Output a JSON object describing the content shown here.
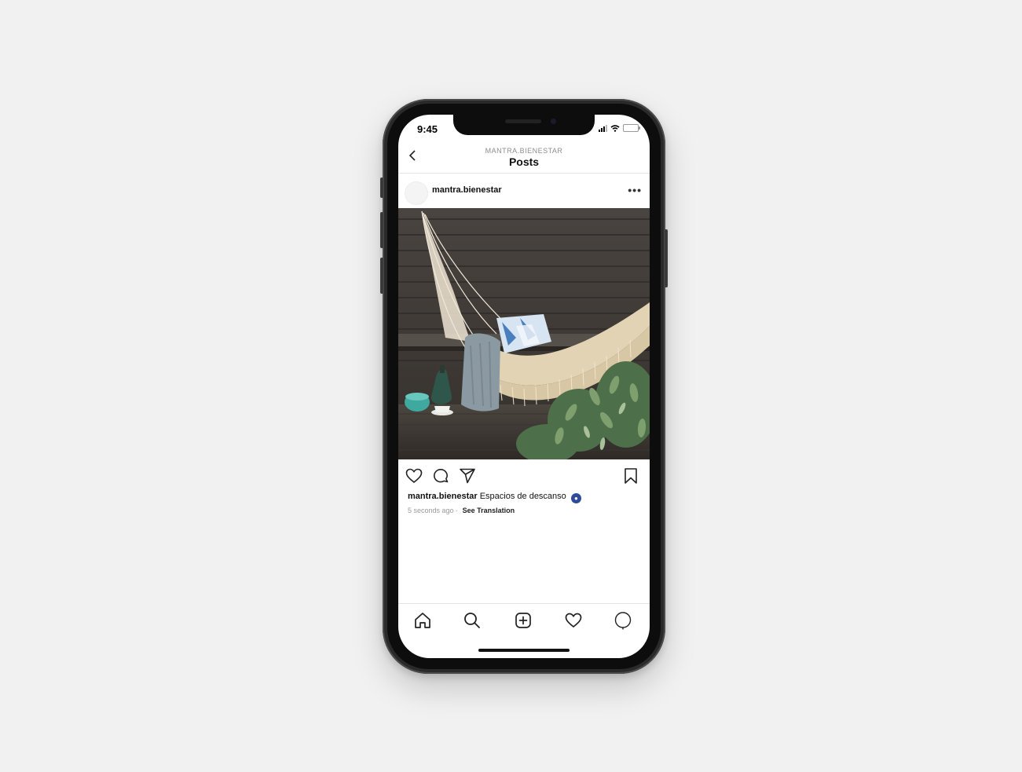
{
  "status_bar": {
    "time": "9:45"
  },
  "header": {
    "subtitle": "MANTRA.BIENESTAR",
    "title": "Posts"
  },
  "post": {
    "username": "mantra.bienestar",
    "caption_user": "mantra.bienestar",
    "caption_text": "Espacios de descanso",
    "timestamp": "5 seconds ago",
    "separator": "·",
    "see_translation": "See Translation",
    "more": "•••",
    "photo_icon": "hammock-photo"
  },
  "actions": {
    "like_icon": "heart-icon",
    "comment_icon": "comment-icon",
    "share_icon": "send-icon",
    "save_icon": "bookmark-icon"
  },
  "tab_bar": {
    "items": [
      "home-icon",
      "search-icon",
      "add-post-icon",
      "activity-heart-icon",
      "profile-icon"
    ]
  },
  "colors": {
    "badge": "#2e4a9a",
    "background": "#f1f1f1",
    "phone_body": "#2a2a2a"
  }
}
